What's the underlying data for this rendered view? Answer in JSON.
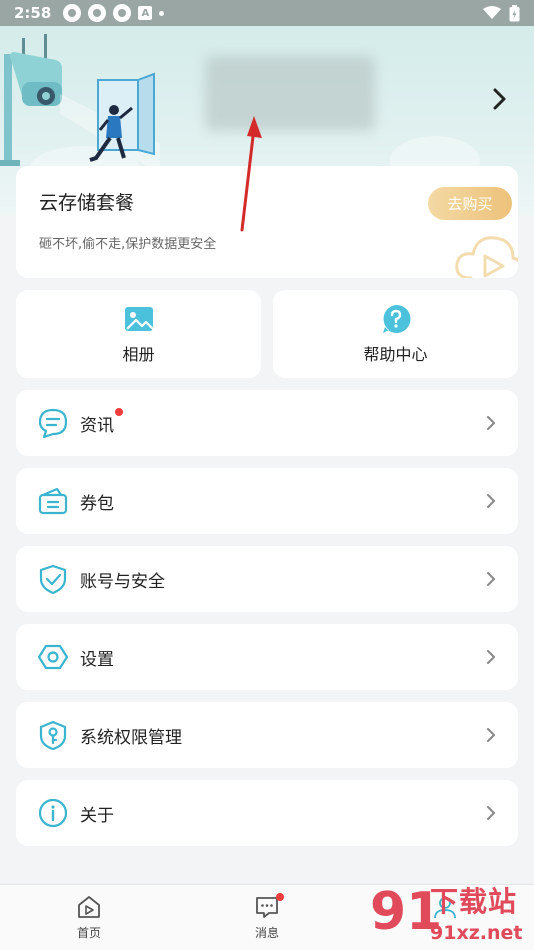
{
  "status_bar": {
    "time": "2:58",
    "a_icon": "A"
  },
  "cloud": {
    "title": "云存储套餐",
    "subtitle": "砸不坏,偷不走,保护数据更安全",
    "buy_label": "去购买"
  },
  "tiles": {
    "album": "相册",
    "help": "帮助中心"
  },
  "menu": {
    "news": "资讯",
    "coupons": "券包",
    "account": "账号与安全",
    "settings": "设置",
    "permissions": "系统权限管理",
    "about": "关于"
  },
  "bottom_nav": {
    "home": "首页",
    "messages": "消息"
  },
  "watermark": {
    "title": "下载站",
    "url": "91xz.net",
    "digits": "91"
  },
  "colors": {
    "accent": "#3ab5cf",
    "buy_gold": "#edc27a",
    "badge_red": "#f03c3c",
    "annotation_red": "#d42a2a"
  },
  "icons": {
    "album": "image-icon",
    "help": "question-icon",
    "news": "chat-bubble-icon",
    "coupons": "wallet-icon",
    "account": "shield-check-icon",
    "settings": "hexagon-gear-icon",
    "permissions": "key-lock-icon",
    "about": "info-icon",
    "chevron": "chevron-right-icon",
    "home": "home-icon",
    "messages": "message-icon"
  }
}
